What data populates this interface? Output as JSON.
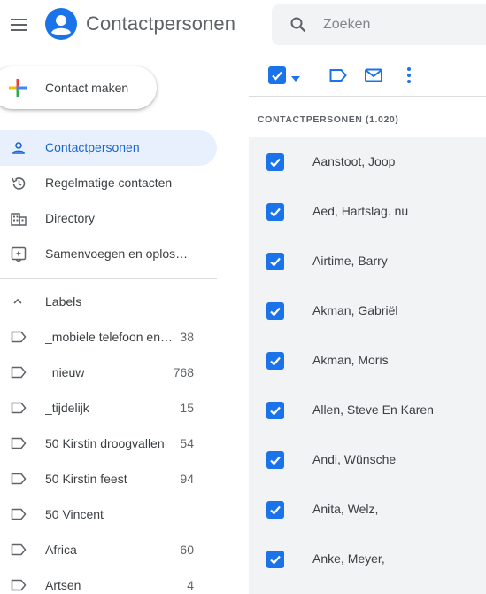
{
  "header": {
    "app_title": "Contactpersonen",
    "search_placeholder": "Zoeken"
  },
  "create_button": {
    "label": "Contact maken"
  },
  "sidebar": {
    "items": [
      {
        "label": "Contactpersonen",
        "icon": "person-icon",
        "active": true
      },
      {
        "label": "Regelmatige contacten",
        "icon": "history-icon",
        "active": false
      },
      {
        "label": "Directory",
        "icon": "building-icon",
        "active": false
      },
      {
        "label": "Samenvoegen en oplos…",
        "icon": "merge-icon",
        "active": false
      }
    ],
    "labels_heading": "Labels",
    "labels": [
      {
        "label": "_mobiele telefoon en…",
        "count": "38"
      },
      {
        "label": "_nieuw",
        "count": "768"
      },
      {
        "label": "_tijdelijk",
        "count": "15"
      },
      {
        "label": "50 Kirstin droogvallen",
        "count": "54"
      },
      {
        "label": "50 Kirstin feest",
        "count": "94"
      },
      {
        "label": "50 Vincent",
        "count": ""
      },
      {
        "label": "Africa",
        "count": "60"
      },
      {
        "label": "Artsen",
        "count": "4"
      }
    ]
  },
  "toolbar": {
    "select_all_checked": true,
    "icons": [
      "checkbox-icon",
      "caret-down-icon",
      "label-icon",
      "mail-icon",
      "more-vert-icon"
    ]
  },
  "list": {
    "heading": "CONTACTPERSONEN (1.020)",
    "rows": [
      {
        "name": "Aanstoot, Joop",
        "checked": true
      },
      {
        "name": "Aed, Hartslag. nu",
        "checked": true
      },
      {
        "name": "Airtime, Barry",
        "checked": true
      },
      {
        "name": "Akman, Gabriël",
        "checked": true
      },
      {
        "name": "Akman, Moris",
        "checked": true
      },
      {
        "name": "Allen, Steve En Karen",
        "checked": true
      },
      {
        "name": "Andi, Wünsche",
        "checked": true
      },
      {
        "name": "Anita, Welz,",
        "checked": true
      },
      {
        "name": "Anke, Meyer,",
        "checked": true
      }
    ]
  },
  "colors": {
    "accent": "#1a73e8",
    "active_bg": "#e8f0fe",
    "active_text": "#1967d2",
    "list_bg": "#f1f3f4"
  }
}
